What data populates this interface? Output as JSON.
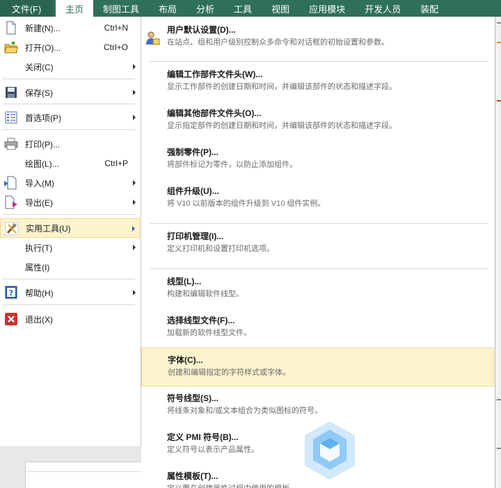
{
  "ribbon": {
    "file": "文件(F)",
    "tabs": [
      "主页",
      "制图工具",
      "布局",
      "分析",
      "工具",
      "视图",
      "应用模块",
      "开发人员",
      "装配"
    ]
  },
  "menu": [
    {
      "label": "新建(N)...",
      "shortcut": "Ctrl+N",
      "icon": "new-document-icon"
    },
    {
      "label": "打开(O)...",
      "shortcut": "Ctrl+O",
      "icon": "open-folder-icon"
    },
    {
      "label": "关闭(C)",
      "submenu": true
    },
    {
      "label": "保存(S)",
      "submenu": true,
      "icon": "save-disk-icon"
    },
    {
      "label": "首选项(P)",
      "submenu": true,
      "icon": "preferences-list-icon"
    },
    {
      "label": "打印(P)...",
      "icon": "printer-icon"
    },
    {
      "label": "绘图(L)...",
      "shortcut": "Ctrl+P"
    },
    {
      "label": "导入(M)",
      "submenu": true,
      "icon": "import-icon"
    },
    {
      "label": "导出(E)",
      "submenu": true,
      "icon": "export-icon"
    },
    {
      "label": "实用工具(U)",
      "submenu": true,
      "icon": "utilities-tools-icon"
    },
    {
      "label": "执行(T)",
      "submenu": true
    },
    {
      "label": "属性(I)"
    },
    {
      "label": "帮助(H)",
      "submenu": true,
      "icon": "help-icon"
    },
    {
      "label": "退出(X)",
      "icon": "exit-icon"
    }
  ],
  "submenu": [
    {
      "title": "用户默认设置(D)...",
      "desc": "在站点、组和用户级别控制众多命令和对话框的初始设置和参数。",
      "icon": "user-defaults-icon"
    },
    {
      "title": "编辑工作部件文件头(W)...",
      "desc": "显示工作部件的创建日期和时间，并编辑该部件的状态和描述字段。"
    },
    {
      "title": "编辑其他部件文件头(O)...",
      "desc": "显示指定部件的创建日期和时间，并编辑该部件的状态和描述字段。"
    },
    {
      "title": "强制零件(P)...",
      "desc": "将部件标记为零件，以防止添加组件。"
    },
    {
      "title": "组件升级(U)...",
      "desc": "将 V10 以前版本的组件升级到 V10 组件实例。"
    },
    {
      "title": "打印机管理(I)...",
      "desc": "定义打印机和设置打印机选项。"
    },
    {
      "title": "线型(L)...",
      "desc": "构建和编辑软件线型。"
    },
    {
      "title": "选择线型文件(F)...",
      "desc": "加载新的软件线型文件。"
    },
    {
      "title": "字体(C)...",
      "desc": "创建和编辑指定的字符样式或字体。"
    },
    {
      "title": "符号线型(S)...",
      "desc": "将线条对象和/或文本组合为类似图标的符号。"
    },
    {
      "title": "定义 PMI 符号(B)...",
      "desc": "定义符号以表示产品属性。"
    },
    {
      "title": "属性模板(T)...",
      "desc": "定义要在创建属性过程中使用的模板"
    }
  ]
}
